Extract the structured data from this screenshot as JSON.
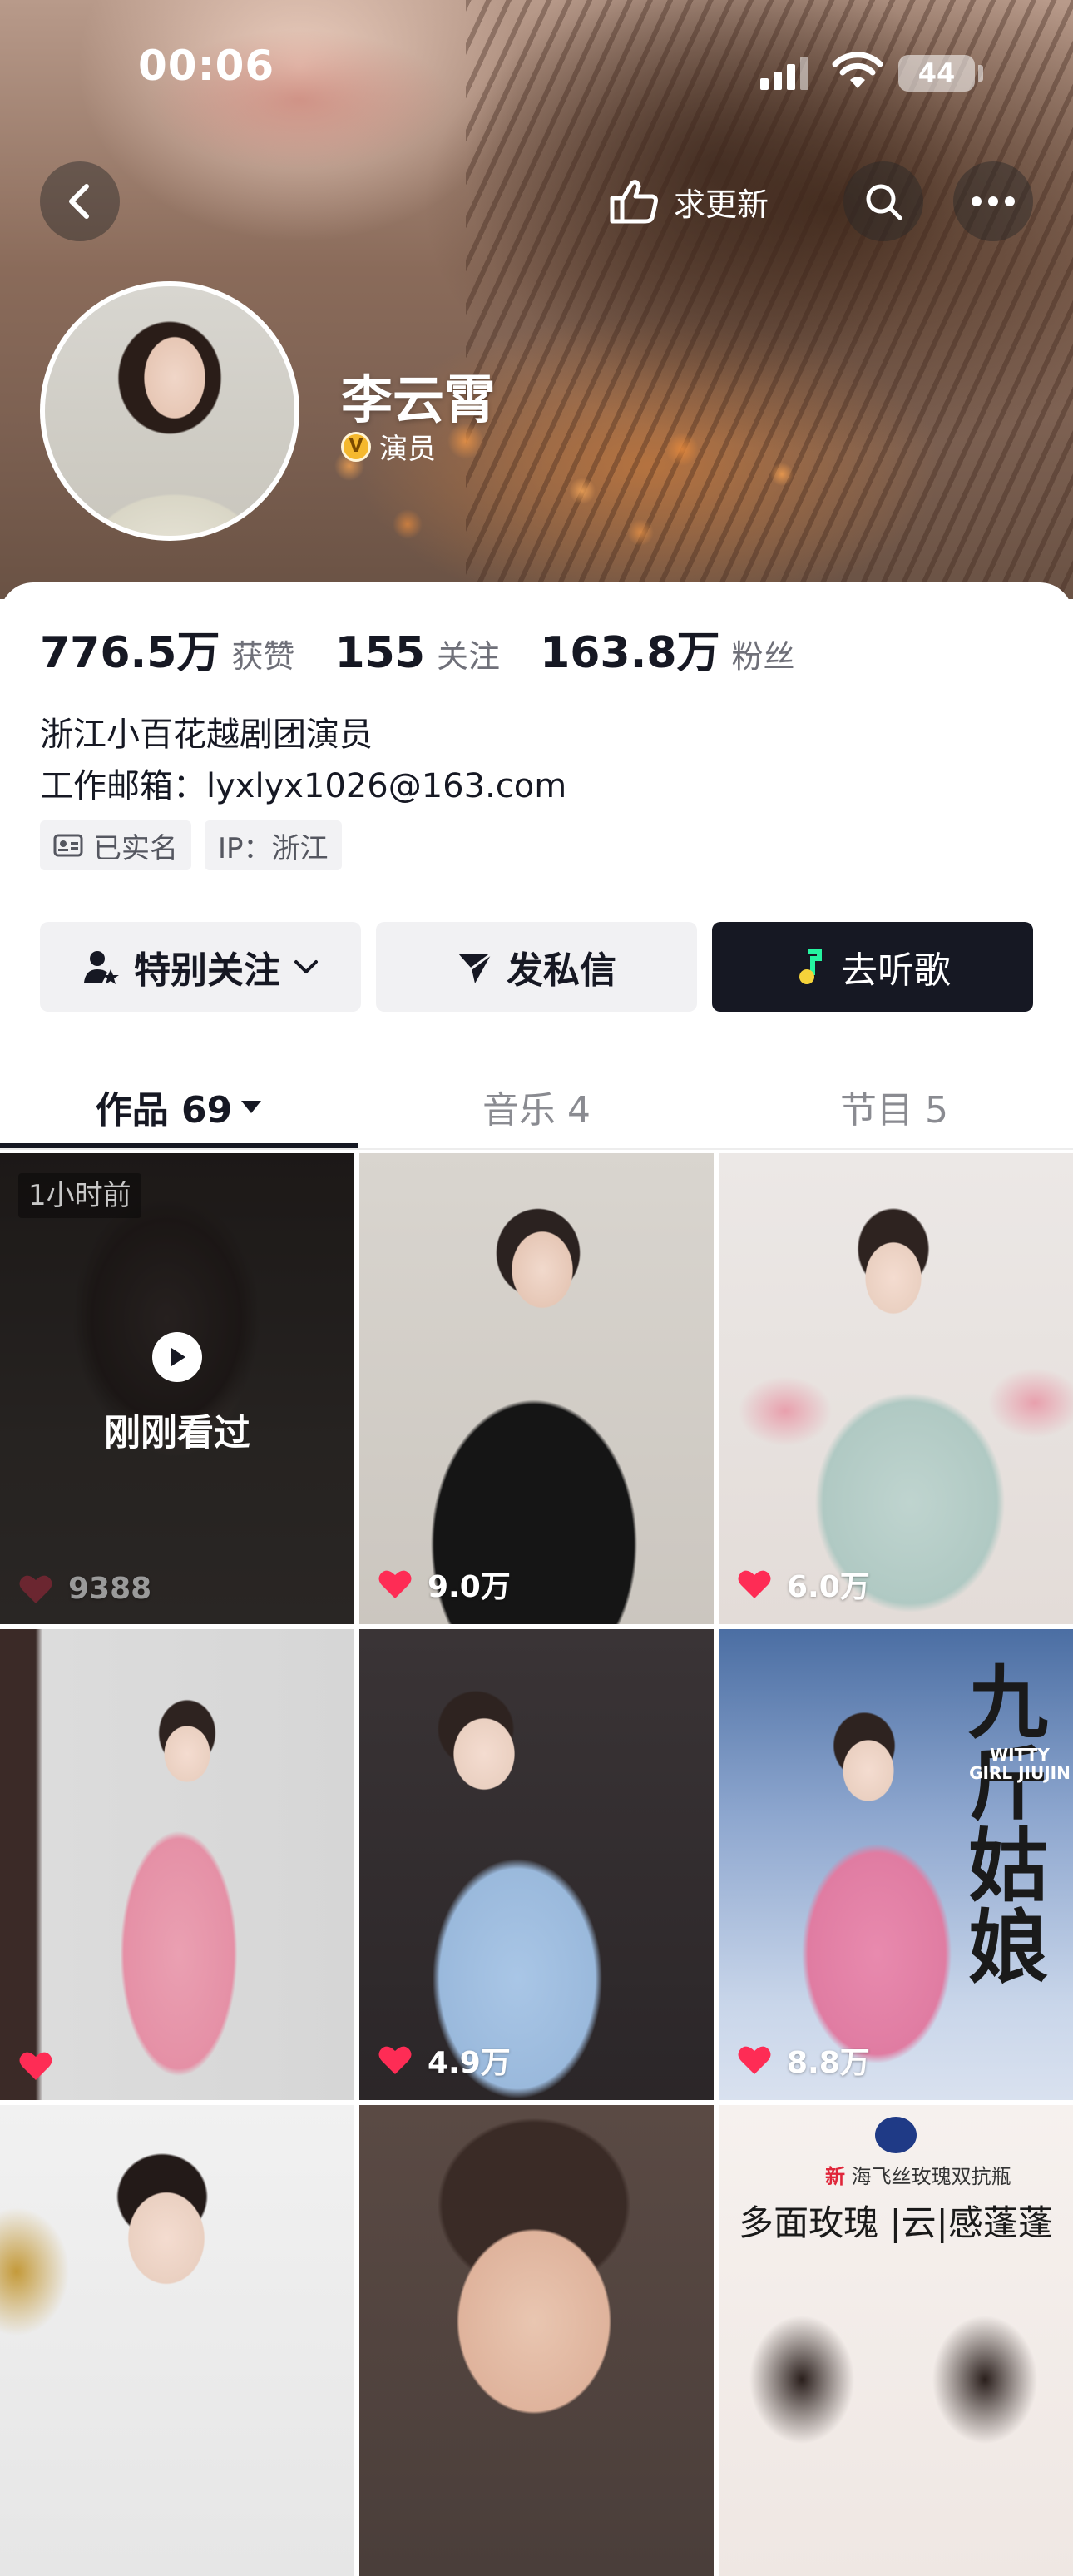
{
  "status_bar": {
    "time": "00:06",
    "battery": "44"
  },
  "top_nav": {
    "request_update_label": "求更新"
  },
  "profile": {
    "name": "李云霄",
    "verified_badge_letter": "V",
    "verified_title": "演员"
  },
  "stats": [
    {
      "value": "776.5万",
      "label": "获赞"
    },
    {
      "value": "155",
      "label": "关注"
    },
    {
      "value": "163.8万",
      "label": "粉丝"
    }
  ],
  "bio": {
    "line1": "浙江小百花越剧团演员",
    "line2": "工作邮箱：lyxlyx1026@163.com"
  },
  "tags": {
    "verified": "已实名",
    "ip": "IP：浙江"
  },
  "actions": {
    "follow": "特别关注",
    "message": "发私信",
    "music": "去听歌"
  },
  "tabs": [
    {
      "label": "作品 69"
    },
    {
      "label": "音乐 4"
    },
    {
      "label": "节目 5"
    }
  ],
  "grid": [
    {
      "likes": "9388",
      "time_badge": "1小时前",
      "watched_label": "刚刚看过"
    },
    {
      "likes": "9.0万"
    },
    {
      "likes": "6.0万"
    },
    {
      "likes": ""
    },
    {
      "likes": "4.9万"
    },
    {
      "likes": "8.8万",
      "poster_title": "九斤姑娘",
      "poster_en": "WITTY GIRL JIUJIN"
    },
    {
      "likes": ""
    },
    {
      "likes": ""
    },
    {
      "likes": "",
      "ad_logo": "head&shoulders 海飞丝",
      "ad_new": "新",
      "ad_small": "海飞丝玫瑰双抗瓶",
      "ad_title": "多面玫瑰 |云|感蓬蓬"
    }
  ],
  "colors": {
    "accent_dark": "#161823",
    "like_red": "#fe2c55",
    "music_green": "#25f4a0"
  },
  "icons": [
    "back-icon",
    "hand-point-icon",
    "search-icon",
    "more-icon",
    "signal-icon",
    "wifi-icon",
    "id-card-icon",
    "user-star-icon",
    "chevron-down-icon",
    "send-icon",
    "music-note-icon",
    "caret-down-icon",
    "play-icon",
    "heart-icon"
  ]
}
